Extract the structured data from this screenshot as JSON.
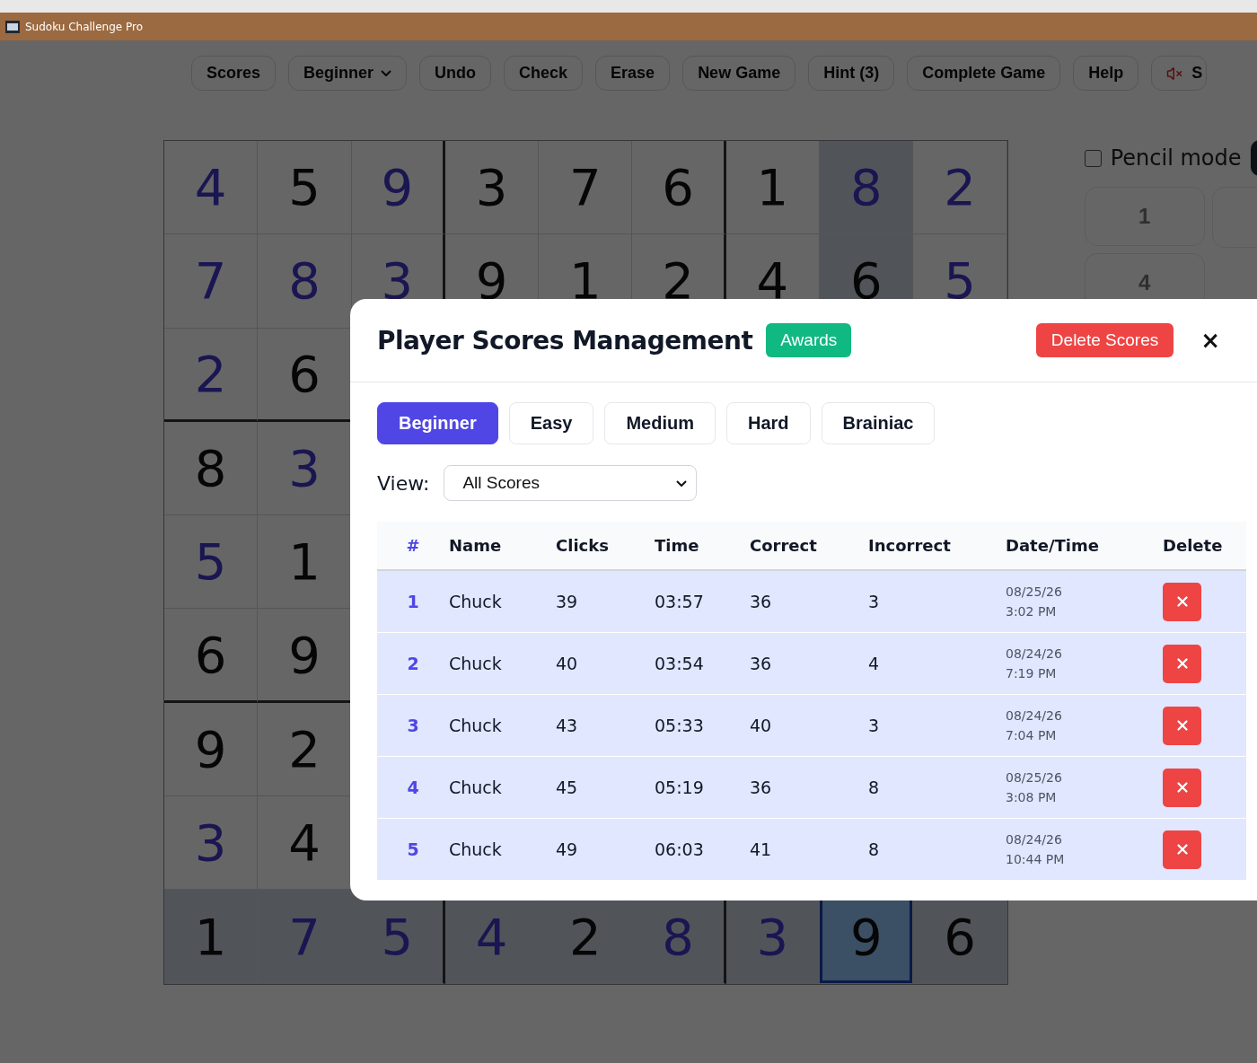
{
  "window": {
    "title": "Sudoku Challenge Pro"
  },
  "toolbar": [
    {
      "label": "Scores",
      "kind": "button"
    },
    {
      "label": "Beginner",
      "kind": "dropdown"
    },
    {
      "label": "Undo",
      "kind": "button"
    },
    {
      "label": "Check",
      "kind": "button"
    },
    {
      "label": "Erase",
      "kind": "button"
    },
    {
      "label": "New Game",
      "kind": "button"
    },
    {
      "label": "Hint (3)",
      "kind": "button"
    },
    {
      "label": "Complete Game",
      "kind": "button"
    },
    {
      "label": "Help",
      "kind": "button"
    },
    {
      "label": "S",
      "kind": "sound"
    }
  ],
  "board": {
    "rows": [
      [
        {
          "digit": "4",
          "given": false,
          "selected": false
        },
        {
          "digit": "5",
          "given": true,
          "selected": false
        },
        {
          "digit": "9",
          "given": false,
          "selected": false
        },
        {
          "digit": "3",
          "given": true,
          "selected": false
        },
        {
          "digit": "7",
          "given": true,
          "selected": false
        },
        {
          "digit": "6",
          "given": true,
          "selected": false
        },
        {
          "digit": "1",
          "given": true,
          "selected": false
        },
        {
          "digit": "8",
          "given": false,
          "selected": false
        },
        {
          "digit": "2",
          "given": false,
          "selected": false
        }
      ],
      [
        {
          "digit": "7",
          "given": false,
          "selected": false
        },
        {
          "digit": "8",
          "given": false,
          "selected": false
        },
        {
          "digit": "3",
          "given": false,
          "selected": false
        },
        {
          "digit": "9",
          "given": true,
          "selected": false
        },
        {
          "digit": "1",
          "given": true,
          "selected": false
        },
        {
          "digit": "2",
          "given": true,
          "selected": false
        },
        {
          "digit": "4",
          "given": true,
          "selected": false
        },
        {
          "digit": "6",
          "given": true,
          "selected": false
        },
        {
          "digit": "5",
          "given": false,
          "selected": false
        }
      ],
      [
        {
          "digit": "2",
          "given": false,
          "selected": false
        },
        {
          "digit": "6",
          "given": true,
          "selected": false
        }
      ],
      [
        {
          "digit": "8",
          "given": true,
          "selected": false
        },
        {
          "digit": "3",
          "given": false,
          "selected": false
        }
      ],
      [
        {
          "digit": "5",
          "given": false,
          "selected": false
        },
        {
          "digit": "1",
          "given": true,
          "selected": false
        }
      ],
      [
        {
          "digit": "6",
          "given": true,
          "selected": false
        },
        {
          "digit": "9",
          "given": true,
          "selected": false
        }
      ],
      [
        {
          "digit": "9",
          "given": true,
          "selected": false
        },
        {
          "digit": "2",
          "given": true,
          "selected": false
        }
      ],
      [
        {
          "digit": "3",
          "given": false,
          "selected": false
        },
        {
          "digit": "4",
          "given": true,
          "selected": false
        }
      ],
      [
        {
          "digit": "1",
          "given": true,
          "selected": false
        },
        {
          "digit": "7",
          "given": false,
          "selected": false
        },
        {
          "digit": "5",
          "given": false,
          "selected": false
        },
        {
          "digit": "4",
          "given": false,
          "selected": false
        },
        {
          "digit": "2",
          "given": true,
          "selected": false
        },
        {
          "digit": "8",
          "given": false,
          "selected": false
        },
        {
          "digit": "3",
          "given": false,
          "selected": false
        },
        {
          "digit": "9",
          "given": true,
          "selected": true
        },
        {
          "digit": "6",
          "given": true,
          "selected": false
        }
      ]
    ]
  },
  "side_panel": {
    "pencil_mode": {
      "label": "Pencil mode",
      "checked": false
    },
    "number_pad": [
      "1",
      "4"
    ]
  },
  "modal": {
    "title": "Player Scores Management",
    "awards_button": "Awards",
    "delete_scores_button": "Delete Scores",
    "close": "×",
    "tabs": [
      {
        "label": "Beginner",
        "selected": true
      },
      {
        "label": "Easy",
        "selected": false
      },
      {
        "label": "Medium",
        "selected": false
      },
      {
        "label": "Hard",
        "selected": false
      },
      {
        "label": "Brainiac",
        "selected": false
      }
    ],
    "view": {
      "label": "View:",
      "value": "All Scores"
    },
    "table": {
      "columns": [
        "#",
        "Name",
        "Clicks",
        "Time",
        "Correct",
        "Incorrect",
        "Date/Time",
        "Delete"
      ],
      "rows": [
        {
          "rank": "1",
          "name": "Chuck",
          "clicks": "39",
          "time": "03:57",
          "correct": "36",
          "incorrect": "3",
          "date": "08/25/26",
          "clock": "3:02 PM"
        },
        {
          "rank": "2",
          "name": "Chuck",
          "clicks": "40",
          "time": "03:54",
          "correct": "36",
          "incorrect": "4",
          "date": "08/24/26",
          "clock": "7:19 PM"
        },
        {
          "rank": "3",
          "name": "Chuck",
          "clicks": "43",
          "time": "05:33",
          "correct": "40",
          "incorrect": "3",
          "date": "08/24/26",
          "clock": "7:04 PM"
        },
        {
          "rank": "4",
          "name": "Chuck",
          "clicks": "45",
          "time": "05:19",
          "correct": "36",
          "incorrect": "8",
          "date": "08/25/26",
          "clock": "3:08 PM"
        },
        {
          "rank": "5",
          "name": "Chuck",
          "clicks": "49",
          "time": "06:03",
          "correct": "41",
          "incorrect": "8",
          "date": "08/24/26",
          "clock": "10:44 PM"
        }
      ]
    }
  }
}
